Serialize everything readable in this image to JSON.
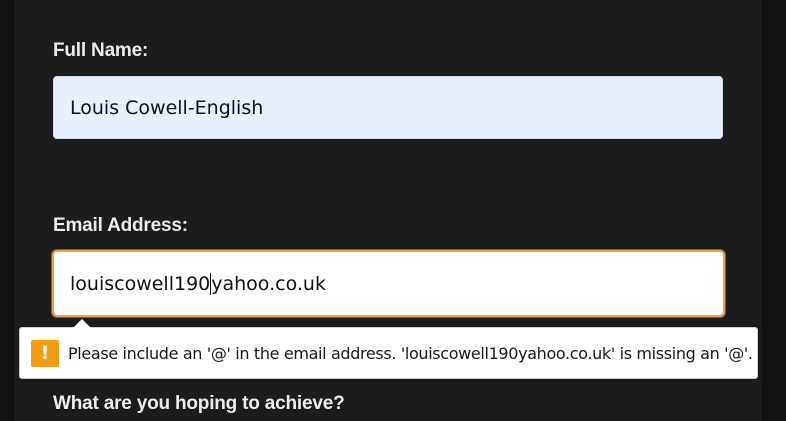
{
  "form": {
    "full_name_label": "Full Name:",
    "full_name_value": "Louis Cowell-English",
    "email_label": "Email Address:",
    "email_value_before_caret": "louiscowell190",
    "email_value_after_caret": "yahoo.co.uk",
    "achieve_label": "What are you hoping to achieve?"
  },
  "validation_tooltip": {
    "icon": "warning-exclamation-icon",
    "icon_glyph": "!",
    "message": "Please include an '@' in the email address. 'louiscowell190yahoo.co.uk' is missing an '@'.",
    "icon_color": "#f39c12"
  },
  "colors": {
    "panel_background": "#1c1c1c",
    "focus_outline": "#f0a24a",
    "autofill_background": "#e8f0fe"
  }
}
